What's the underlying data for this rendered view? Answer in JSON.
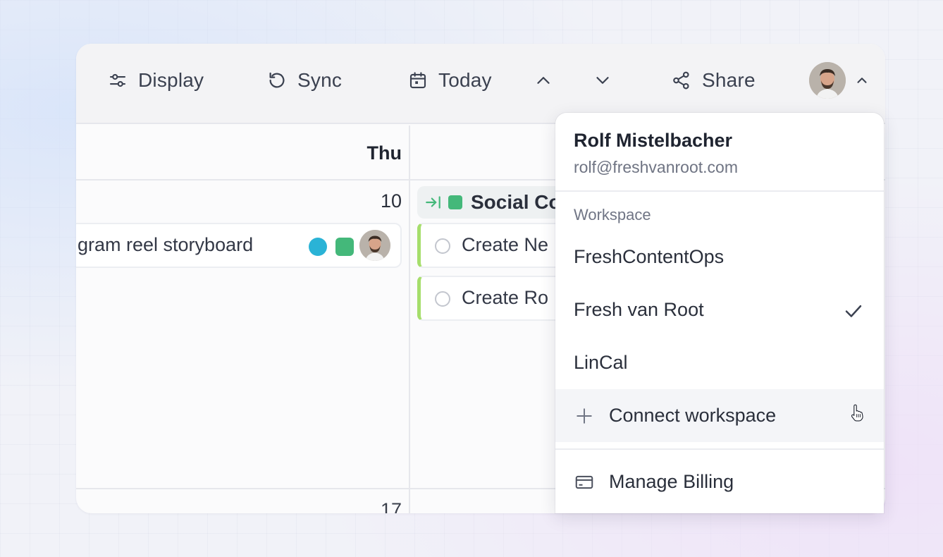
{
  "toolbar": {
    "display_label": "Display",
    "sync_label": "Sync",
    "today_label": "Today",
    "share_label": "Share"
  },
  "calendar": {
    "day_header": "Thu",
    "dates": [
      "10",
      "17"
    ],
    "events": [
      {
        "title": "gram reel storyboard",
        "color_dot": "#2ab3d6",
        "color_square": "#44b87a"
      }
    ],
    "project": {
      "label": "Social Co",
      "color": "#44b87a"
    },
    "tasks": [
      {
        "label": "Create Ne"
      },
      {
        "label": "Create Ro"
      }
    ]
  },
  "account_menu": {
    "user_name": "Rolf Mistelbacher",
    "user_email": "rolf@freshvanroot.com",
    "section_label": "Workspace",
    "workspaces": [
      {
        "name": "FreshContentOps",
        "selected": false
      },
      {
        "name": "Fresh van Root",
        "selected": true
      },
      {
        "name": "LinCal",
        "selected": false
      }
    ],
    "connect_label": "Connect workspace",
    "billing_label": "Manage Billing"
  },
  "colors": {
    "task_accent": "#a6de6c",
    "selected_check": "#3b4150"
  },
  "icons": [
    "sliders-icon",
    "sync-icon",
    "calendar-icon",
    "chevron-up-icon",
    "chevron-down-icon",
    "share-icon",
    "arrow-to-line-icon",
    "check-icon",
    "plus-icon",
    "credit-card-icon",
    "hand-cursor-icon"
  ]
}
